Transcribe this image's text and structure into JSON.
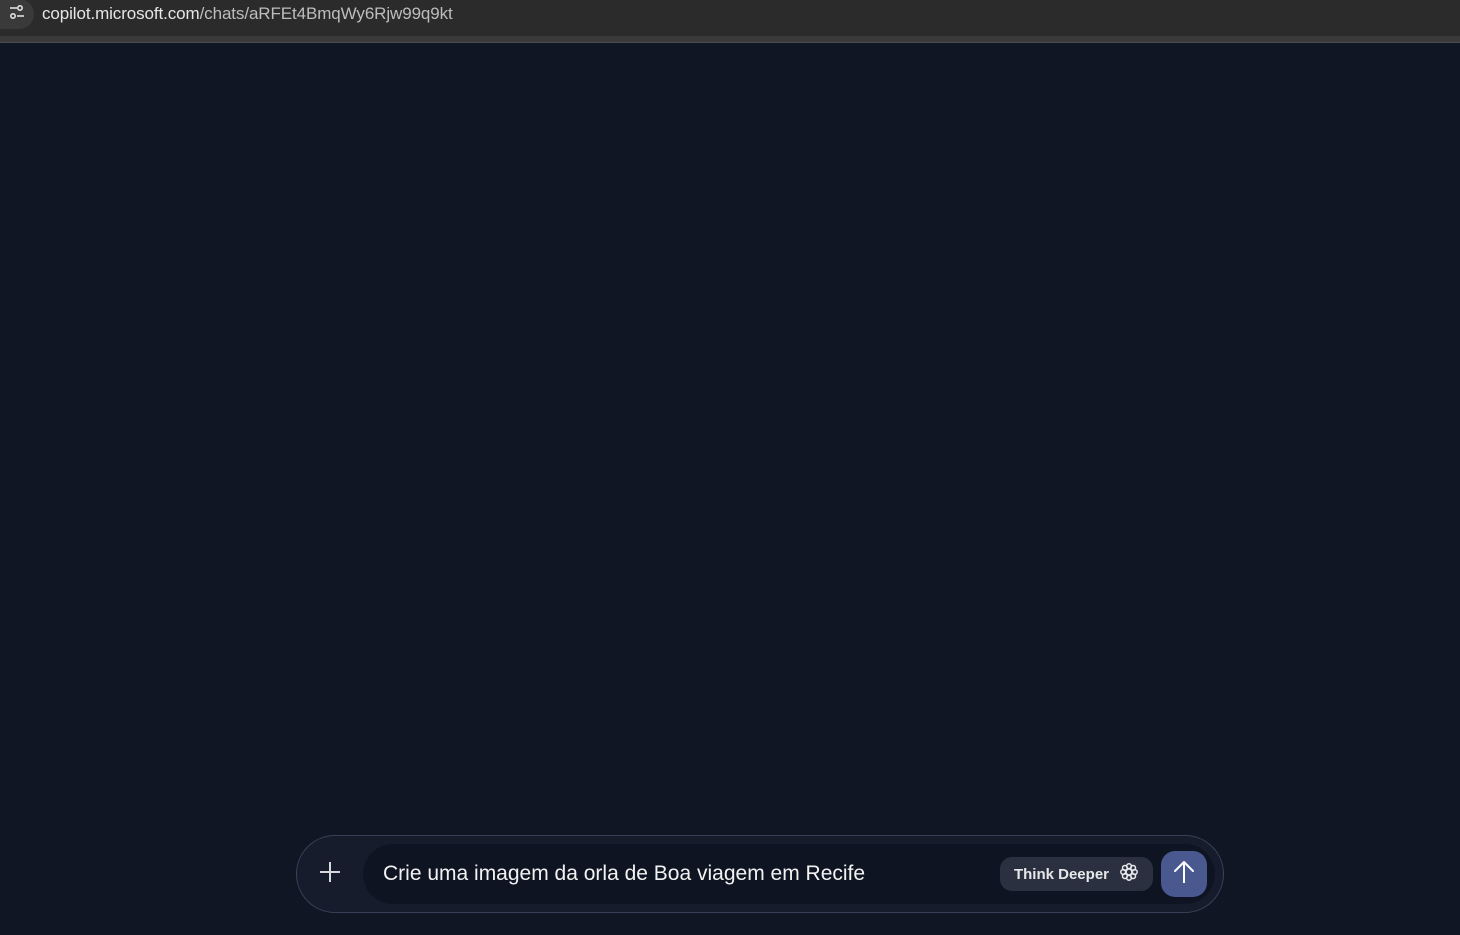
{
  "browser": {
    "url_host": "copilot.microsoft.com",
    "url_path": "/chats/aRFEt4BmqWy6Rjw99q9kt",
    "site_info_icon": "tune-icon"
  },
  "composer": {
    "add_icon": "plus-icon",
    "prompt_value": "Crie uma imagem da orla de Boa viagem em Recife",
    "think_deeper_label": "Think Deeper",
    "think_deeper_icon": "gear-icon",
    "send_icon": "arrow-up-icon",
    "send_color": "#4a5890"
  }
}
